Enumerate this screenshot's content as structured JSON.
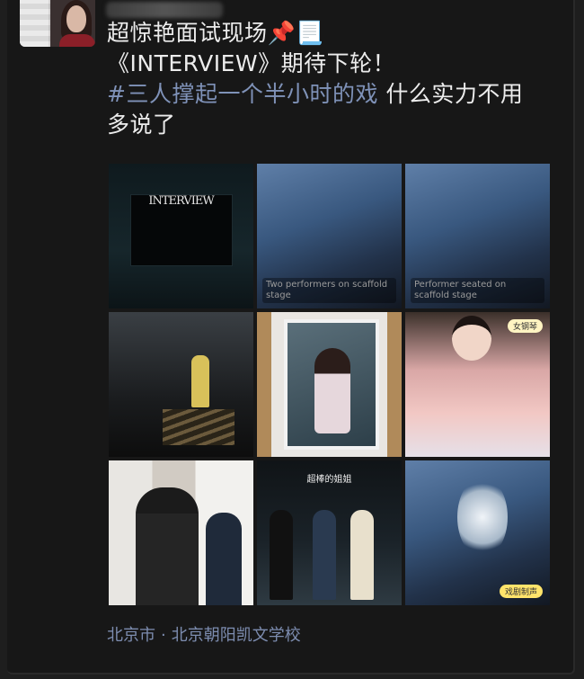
{
  "post": {
    "line1": "超惊艳面试现场📌📃",
    "line2": "《INTERVIEW》期待下轮！",
    "hashtag": "#三人撑起一个半小时的戏",
    "line3_rest": " 什么实力不用",
    "line4": "多说了"
  },
  "photos": [
    {
      "name": "photo-interview-screen",
      "logo": "INTERVIEW",
      "caption": "Stage screen with INTERVIEW logo"
    },
    {
      "name": "photo-stage-two-actors",
      "caption": "Two performers on scaffold stage"
    },
    {
      "name": "photo-stage-seated-actor",
      "caption": "Performer seated on scaffold stage"
    },
    {
      "name": "photo-actor-on-stairs",
      "caption": "Performer in yellow coat on stairs"
    },
    {
      "name": "photo-poster-frame",
      "caption": "Framed poster of actress"
    },
    {
      "name": "photo-flowers-bouquet",
      "badge": "女钢琴",
      "caption": "Actress with flower bouquets"
    },
    {
      "name": "photo-backstage-selfie",
      "caption": "Performers backstage"
    },
    {
      "name": "photo-curtain-call",
      "top_caption": "超棒的姐姐",
      "caption": "Three performers with bouquets"
    },
    {
      "name": "photo-stage-tree",
      "tag": "戏剧制声",
      "caption": "Stage with white tree projection"
    }
  ],
  "location": {
    "city": "北京市",
    "separator": "·",
    "venue": "北京朝阳凯文学校"
  }
}
